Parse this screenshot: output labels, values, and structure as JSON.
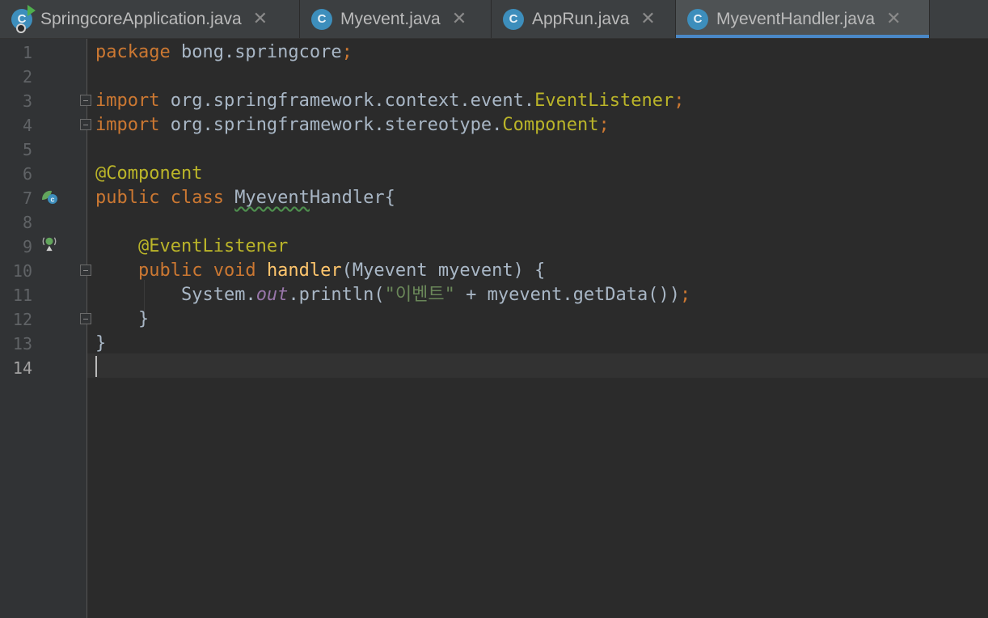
{
  "tabs": [
    {
      "label": "SpringcoreApplication.java",
      "icon": "spring-boot-class-icon",
      "active": false
    },
    {
      "label": "Myevent.java",
      "icon": "class-icon",
      "active": false
    },
    {
      "label": "AppRun.java",
      "icon": "class-icon",
      "active": false
    },
    {
      "label": "MyeventHandler.java",
      "icon": "class-icon",
      "active": true
    }
  ],
  "tab_icon_letter": "C",
  "close_glyph": "✕",
  "line_numbers": [
    "1",
    "2",
    "3",
    "4",
    "5",
    "6",
    "7",
    "8",
    "9",
    "10",
    "11",
    "12",
    "13",
    "14"
  ],
  "current_line": "14",
  "code": {
    "l1": {
      "kw": "package",
      "rest": " bong.springcore",
      "semi": ";"
    },
    "l3": {
      "kw": "import",
      "pkg": " org.springframework.context.event.",
      "cls": "EventListener",
      "semi": ";"
    },
    "l4": {
      "kw": "import",
      "pkg": " org.springframework.stereotype.",
      "cls": "Component",
      "semi": ";"
    },
    "l6": {
      "ann": "@Component"
    },
    "l7": {
      "kw": "public class ",
      "name_a": "Myevent",
      "name_b": "Handler",
      "brace": "{"
    },
    "l9": {
      "ann": "@EventListener"
    },
    "l10": {
      "kw": "public void ",
      "fn": "handler",
      "params": "(Myevent myevent) {"
    },
    "l11": {
      "obj": "System.",
      "field": "out",
      "call": ".println(",
      "str": "\"이벤트\"",
      "rest": " + myevent.getData())",
      "semi": ";"
    },
    "l12": {
      "brace": "}"
    },
    "l13": {
      "brace": "}"
    }
  },
  "colors": {
    "keyword": "#cc7832",
    "annotation": "#bbb529",
    "method": "#ffc66d",
    "string": "#6a8759",
    "field": "#9876aa",
    "text": "#a9b7c6",
    "background": "#2b2b2b",
    "gutter": "#313335",
    "active_tab_underline": "#4a88c7"
  }
}
